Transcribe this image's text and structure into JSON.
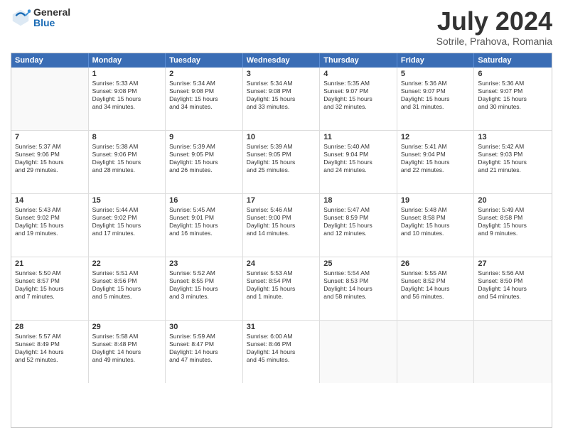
{
  "logo": {
    "general": "General",
    "blue": "Blue"
  },
  "title": "July 2024",
  "subtitle": "Sotrile, Prahova, Romania",
  "header_days": [
    "Sunday",
    "Monday",
    "Tuesday",
    "Wednesday",
    "Thursday",
    "Friday",
    "Saturday"
  ],
  "weeks": [
    [
      {
        "day": "",
        "lines": []
      },
      {
        "day": "1",
        "lines": [
          "Sunrise: 5:33 AM",
          "Sunset: 9:08 PM",
          "Daylight: 15 hours",
          "and 34 minutes."
        ]
      },
      {
        "day": "2",
        "lines": [
          "Sunrise: 5:34 AM",
          "Sunset: 9:08 PM",
          "Daylight: 15 hours",
          "and 34 minutes."
        ]
      },
      {
        "day": "3",
        "lines": [
          "Sunrise: 5:34 AM",
          "Sunset: 9:08 PM",
          "Daylight: 15 hours",
          "and 33 minutes."
        ]
      },
      {
        "day": "4",
        "lines": [
          "Sunrise: 5:35 AM",
          "Sunset: 9:07 PM",
          "Daylight: 15 hours",
          "and 32 minutes."
        ]
      },
      {
        "day": "5",
        "lines": [
          "Sunrise: 5:36 AM",
          "Sunset: 9:07 PM",
          "Daylight: 15 hours",
          "and 31 minutes."
        ]
      },
      {
        "day": "6",
        "lines": [
          "Sunrise: 5:36 AM",
          "Sunset: 9:07 PM",
          "Daylight: 15 hours",
          "and 30 minutes."
        ]
      }
    ],
    [
      {
        "day": "7",
        "lines": [
          "Sunrise: 5:37 AM",
          "Sunset: 9:06 PM",
          "Daylight: 15 hours",
          "and 29 minutes."
        ]
      },
      {
        "day": "8",
        "lines": [
          "Sunrise: 5:38 AM",
          "Sunset: 9:06 PM",
          "Daylight: 15 hours",
          "and 28 minutes."
        ]
      },
      {
        "day": "9",
        "lines": [
          "Sunrise: 5:39 AM",
          "Sunset: 9:05 PM",
          "Daylight: 15 hours",
          "and 26 minutes."
        ]
      },
      {
        "day": "10",
        "lines": [
          "Sunrise: 5:39 AM",
          "Sunset: 9:05 PM",
          "Daylight: 15 hours",
          "and 25 minutes."
        ]
      },
      {
        "day": "11",
        "lines": [
          "Sunrise: 5:40 AM",
          "Sunset: 9:04 PM",
          "Daylight: 15 hours",
          "and 24 minutes."
        ]
      },
      {
        "day": "12",
        "lines": [
          "Sunrise: 5:41 AM",
          "Sunset: 9:04 PM",
          "Daylight: 15 hours",
          "and 22 minutes."
        ]
      },
      {
        "day": "13",
        "lines": [
          "Sunrise: 5:42 AM",
          "Sunset: 9:03 PM",
          "Daylight: 15 hours",
          "and 21 minutes."
        ]
      }
    ],
    [
      {
        "day": "14",
        "lines": [
          "Sunrise: 5:43 AM",
          "Sunset: 9:02 PM",
          "Daylight: 15 hours",
          "and 19 minutes."
        ]
      },
      {
        "day": "15",
        "lines": [
          "Sunrise: 5:44 AM",
          "Sunset: 9:02 PM",
          "Daylight: 15 hours",
          "and 17 minutes."
        ]
      },
      {
        "day": "16",
        "lines": [
          "Sunrise: 5:45 AM",
          "Sunset: 9:01 PM",
          "Daylight: 15 hours",
          "and 16 minutes."
        ]
      },
      {
        "day": "17",
        "lines": [
          "Sunrise: 5:46 AM",
          "Sunset: 9:00 PM",
          "Daylight: 15 hours",
          "and 14 minutes."
        ]
      },
      {
        "day": "18",
        "lines": [
          "Sunrise: 5:47 AM",
          "Sunset: 8:59 PM",
          "Daylight: 15 hours",
          "and 12 minutes."
        ]
      },
      {
        "day": "19",
        "lines": [
          "Sunrise: 5:48 AM",
          "Sunset: 8:58 PM",
          "Daylight: 15 hours",
          "and 10 minutes."
        ]
      },
      {
        "day": "20",
        "lines": [
          "Sunrise: 5:49 AM",
          "Sunset: 8:58 PM",
          "Daylight: 15 hours",
          "and 9 minutes."
        ]
      }
    ],
    [
      {
        "day": "21",
        "lines": [
          "Sunrise: 5:50 AM",
          "Sunset: 8:57 PM",
          "Daylight: 15 hours",
          "and 7 minutes."
        ]
      },
      {
        "day": "22",
        "lines": [
          "Sunrise: 5:51 AM",
          "Sunset: 8:56 PM",
          "Daylight: 15 hours",
          "and 5 minutes."
        ]
      },
      {
        "day": "23",
        "lines": [
          "Sunrise: 5:52 AM",
          "Sunset: 8:55 PM",
          "Daylight: 15 hours",
          "and 3 minutes."
        ]
      },
      {
        "day": "24",
        "lines": [
          "Sunrise: 5:53 AM",
          "Sunset: 8:54 PM",
          "Daylight: 15 hours",
          "and 1 minute."
        ]
      },
      {
        "day": "25",
        "lines": [
          "Sunrise: 5:54 AM",
          "Sunset: 8:53 PM",
          "Daylight: 14 hours",
          "and 58 minutes."
        ]
      },
      {
        "day": "26",
        "lines": [
          "Sunrise: 5:55 AM",
          "Sunset: 8:52 PM",
          "Daylight: 14 hours",
          "and 56 minutes."
        ]
      },
      {
        "day": "27",
        "lines": [
          "Sunrise: 5:56 AM",
          "Sunset: 8:50 PM",
          "Daylight: 14 hours",
          "and 54 minutes."
        ]
      }
    ],
    [
      {
        "day": "28",
        "lines": [
          "Sunrise: 5:57 AM",
          "Sunset: 8:49 PM",
          "Daylight: 14 hours",
          "and 52 minutes."
        ]
      },
      {
        "day": "29",
        "lines": [
          "Sunrise: 5:58 AM",
          "Sunset: 8:48 PM",
          "Daylight: 14 hours",
          "and 49 minutes."
        ]
      },
      {
        "day": "30",
        "lines": [
          "Sunrise: 5:59 AM",
          "Sunset: 8:47 PM",
          "Daylight: 14 hours",
          "and 47 minutes."
        ]
      },
      {
        "day": "31",
        "lines": [
          "Sunrise: 6:00 AM",
          "Sunset: 8:46 PM",
          "Daylight: 14 hours",
          "and 45 minutes."
        ]
      },
      {
        "day": "",
        "lines": []
      },
      {
        "day": "",
        "lines": []
      },
      {
        "day": "",
        "lines": []
      }
    ]
  ]
}
